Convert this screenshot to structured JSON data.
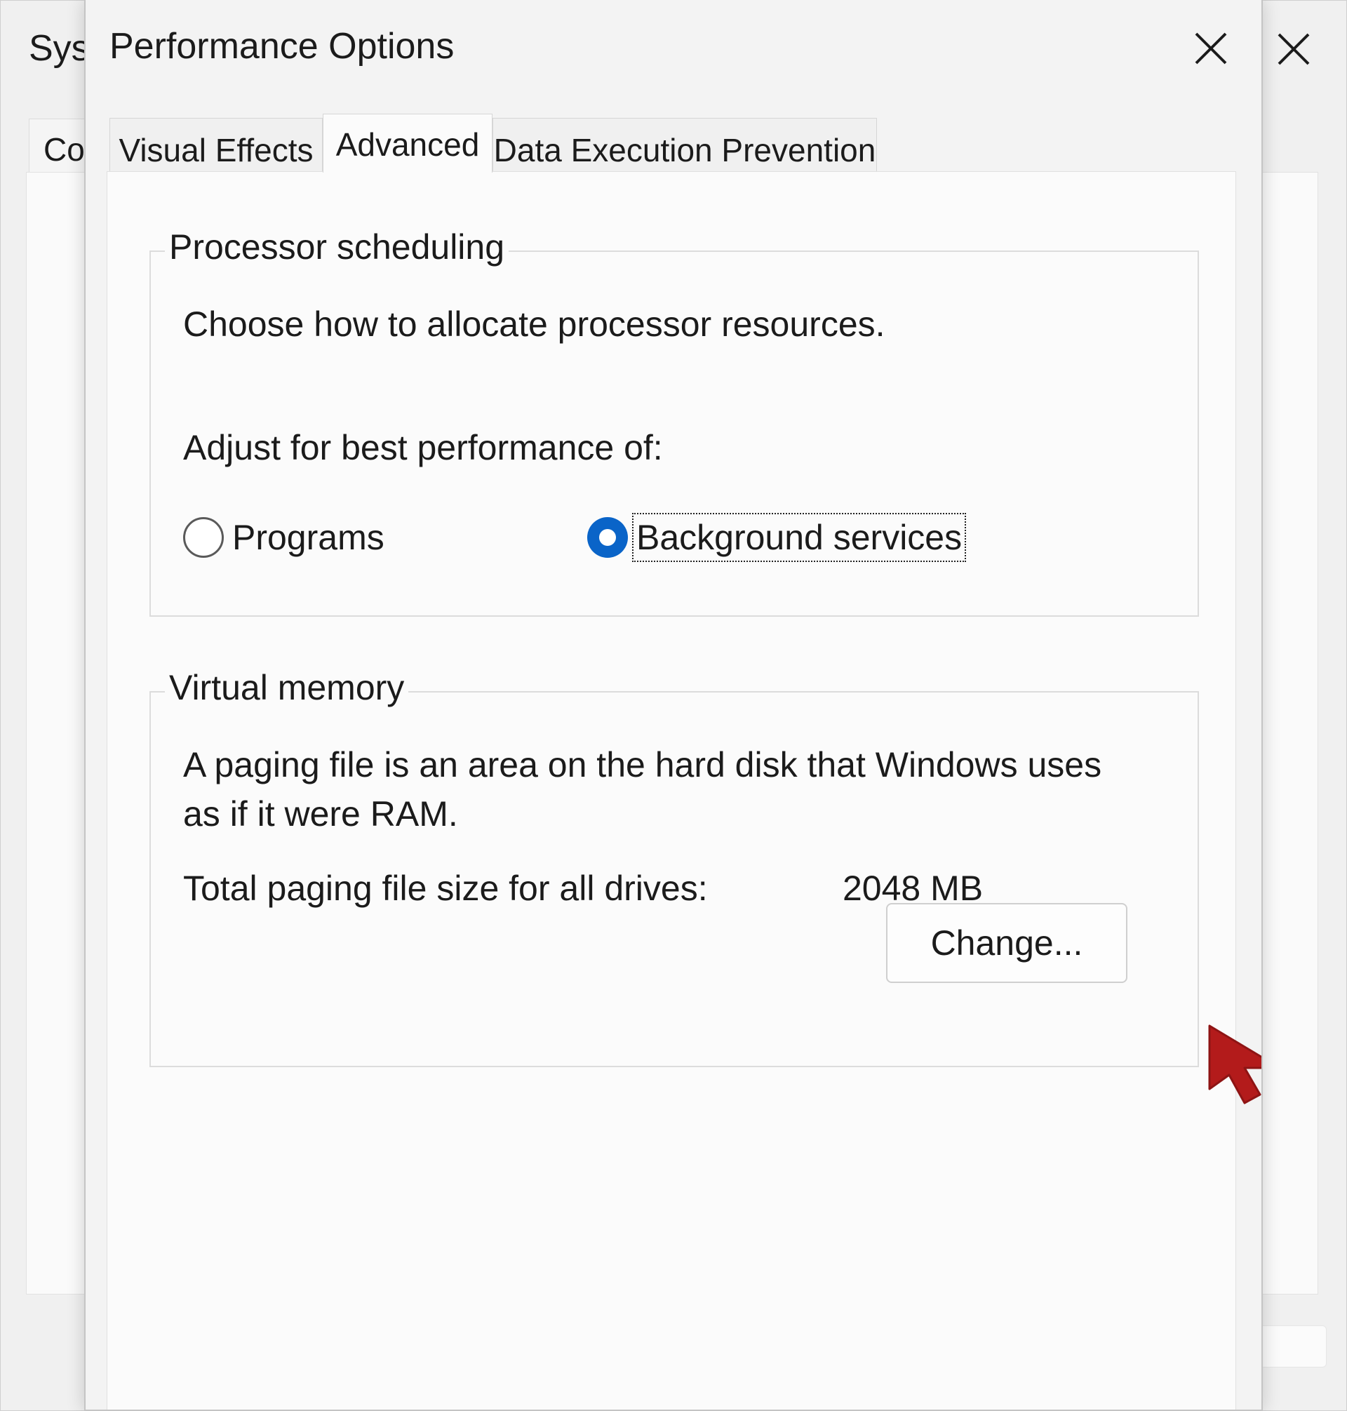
{
  "background_window": {
    "title": "Syst",
    "tab_partial": "Co"
  },
  "dialog": {
    "title": "Performance Options",
    "tabs": [
      {
        "label": "Visual Effects",
        "active": false
      },
      {
        "label": "Advanced",
        "active": true
      },
      {
        "label": "Data Execution Prevention",
        "active": false
      }
    ],
    "processor_scheduling": {
      "legend": "Processor scheduling",
      "description": "Choose how to allocate processor resources.",
      "adjust_label": "Adjust for best performance of:",
      "options": [
        {
          "label": "Programs",
          "checked": false
        },
        {
          "label": "Background services",
          "checked": true
        }
      ]
    },
    "virtual_memory": {
      "legend": "Virtual memory",
      "description_line1": "A paging file is an area on the hard disk that Windows uses",
      "description_line2": "as if it were RAM.",
      "total_label": "Total paging file size for all drives:",
      "total_value": "2048 MB",
      "change_button": "Change..."
    }
  },
  "icons": {
    "close": "close-icon",
    "cursor": "mouse-pointer-icon"
  },
  "colors": {
    "accent": "#0a64c8",
    "cursor": "#b31b1b"
  }
}
